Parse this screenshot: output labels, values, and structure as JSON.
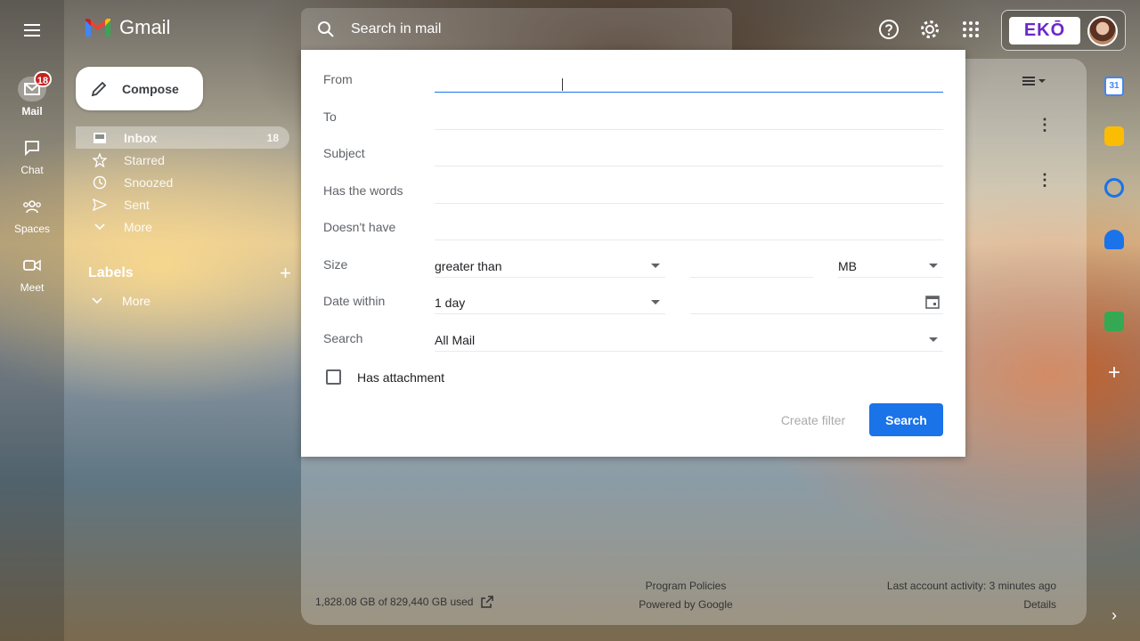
{
  "app": {
    "name": "Gmail"
  },
  "rail": {
    "items": [
      {
        "label": "Mail",
        "icon": "mail-icon",
        "badge": "18",
        "active": true
      },
      {
        "label": "Chat",
        "icon": "chat-icon"
      },
      {
        "label": "Spaces",
        "icon": "spaces-icon"
      },
      {
        "label": "Meet",
        "icon": "meet-icon"
      }
    ]
  },
  "compose": {
    "label": "Compose"
  },
  "nav": {
    "items": [
      {
        "label": "Inbox",
        "icon": "inbox-icon",
        "count": "18",
        "active": true
      },
      {
        "label": "Starred",
        "icon": "star-icon"
      },
      {
        "label": "Snoozed",
        "icon": "clock-icon"
      },
      {
        "label": "Sent",
        "icon": "send-icon"
      },
      {
        "label": "More",
        "icon": "chevron-down-icon"
      }
    ],
    "labels_heading": "Labels",
    "labels_more": "More"
  },
  "search": {
    "placeholder": "Search in mail"
  },
  "account": {
    "logo_text": "EKŌ"
  },
  "dialog": {
    "from_label": "From",
    "to_label": "To",
    "subject_label": "Subject",
    "has_words_label": "Has the words",
    "doesnt_have_label": "Doesn't have",
    "size_label": "Size",
    "size_op": "greater than",
    "size_unit": "MB",
    "date_label": "Date within",
    "date_value": "1 day",
    "search_label": "Search",
    "search_value": "All Mail",
    "has_attachment": "Has attachment",
    "create_filter": "Create filter",
    "search_button": "Search"
  },
  "footer": {
    "storage": "1,828.08 GB of 829,440 GB used",
    "policies": "Program Policies",
    "powered": "Powered by Google",
    "activity": "Last account activity: 3 minutes ago",
    "details": "Details"
  },
  "colors": {
    "accent": "#1a73e8",
    "badge": "#c5221f",
    "eko": "#6a28c9"
  }
}
